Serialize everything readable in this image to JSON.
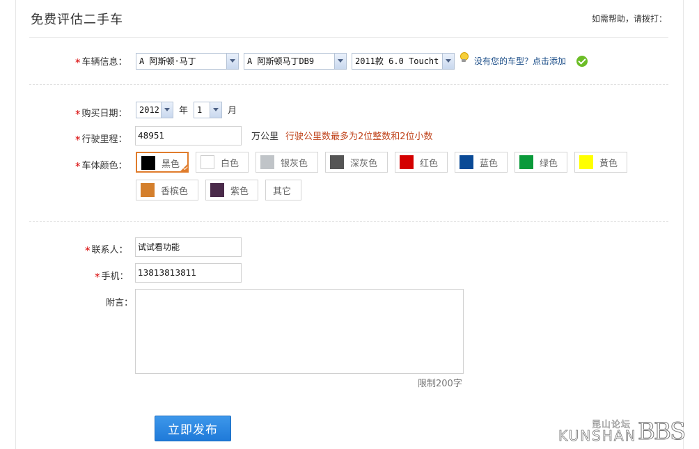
{
  "header": {
    "title": "免费评估二手车",
    "help_text": "如需帮助，请拨打："
  },
  "vehicle": {
    "label": "车辆信息：",
    "brand": "A 阿斯顿·马丁",
    "series": "A 阿斯顿马丁DB9",
    "model": "2011款 6.0 Touchtr",
    "add_link": "没有您的车型？点击添加"
  },
  "purchase": {
    "label": "购买日期：",
    "year": "2012",
    "year_unit": "年",
    "month": "1",
    "month_unit": "月"
  },
  "mileage": {
    "label": "行驶里程：",
    "value": "48951",
    "unit": "万公里",
    "tip": "行驶公里数最多为2位整数和2位小数"
  },
  "color": {
    "label": "车体颜色：",
    "selected": "黑色",
    "options": [
      {
        "name": "黑色",
        "hex": "#000000"
      },
      {
        "name": "白色",
        "hex": "#ffffff"
      },
      {
        "name": "银灰色",
        "hex": "#c0c4c8"
      },
      {
        "name": "深灰色",
        "hex": "#555555"
      },
      {
        "name": "红色",
        "hex": "#d40000"
      },
      {
        "name": "蓝色",
        "hex": "#0a4a96"
      },
      {
        "name": "绿色",
        "hex": "#0a9a3a"
      },
      {
        "name": "黄色",
        "hex": "#ffff00"
      },
      {
        "name": "香槟色",
        "hex": "#d47f2c"
      },
      {
        "name": "紫色",
        "hex": "#4a2a4a"
      },
      {
        "name": "其它",
        "hex": ""
      }
    ]
  },
  "contact": {
    "label": "联系人：",
    "value": "试试看功能"
  },
  "phone": {
    "label": "手机：",
    "value": "13813813811"
  },
  "note": {
    "label": "附言：",
    "value": "",
    "limit": "限制200字"
  },
  "submit_label": "立即发布",
  "watermark": {
    "cn": "昆山论坛",
    "en": "KUNSHAN",
    "bbs": "BBS"
  }
}
